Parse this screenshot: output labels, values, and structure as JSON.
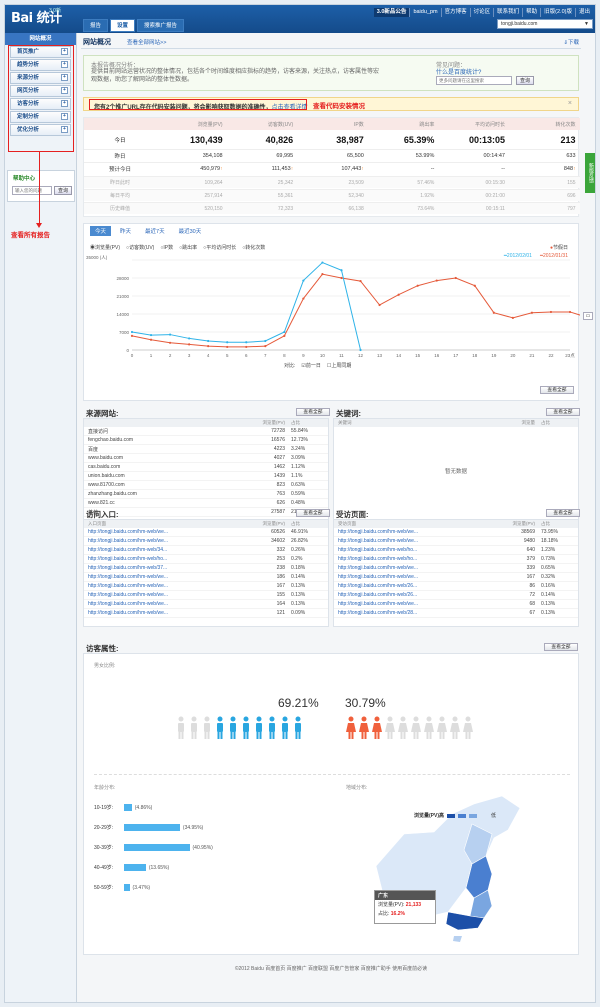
{
  "app": {
    "logo": "Bai 统计",
    "version": "3.0新",
    "tabs": [
      "报告",
      "设置",
      "搜索推广报告"
    ],
    "active_tab": 1,
    "userbar": [
      "3.0新品公告",
      "baidu_pm",
      "官方博客",
      "讨论区",
      "联系我们",
      "帮助",
      "旧版(2.0)版",
      "退出"
    ],
    "site_selector": "tongji.baidu.com"
  },
  "sidebar": {
    "head": "网站概况",
    "items": [
      "首页推广",
      "趋势分析",
      "来源分析",
      "网页分析",
      "访客分析",
      "定制分析",
      "优化分析"
    ],
    "help_title": "帮助中心",
    "help_placeholder": "输入您的问题",
    "help_button": "查询"
  },
  "annotations": {
    "all_reports": "查看所有报告",
    "code_install": "查看代码安装情况"
  },
  "page": {
    "title": "网站概况",
    "subtitle": "查看全部网站>>",
    "download": "下载"
  },
  "notice": {
    "title": "本报告概况分析：",
    "body": "提供目前网站运营状况的整体情况，包括各个时间维度相应指标的趋势，访客来源，关注热点，访客属性等宏观数据，助您了解网站的整体性数据。",
    "faq_title": "常见问题：",
    "faq_link": "什么是百度统计?",
    "search_placeholder": "更多问题请在这里搜索",
    "search_button": "查询"
  },
  "warning": {
    "text": "您有2个推广URL存在代码安装问题，将会影响获取数据的准确性，",
    "link": "点击查看详情",
    "close": "×"
  },
  "stats": {
    "headers": [
      "浏览量(PV)",
      "访客数(UV)",
      "IP数",
      "跳出率",
      "平均访问时长",
      "转化次数"
    ],
    "rows": [
      {
        "label": "今日",
        "values": [
          "130,439",
          "40,826",
          "38,987",
          "65.39%",
          "00:13:05",
          "213"
        ]
      },
      {
        "label": "昨日",
        "values": [
          "354,108",
          "69,995",
          "65,500",
          "53.99%",
          "00:14:47",
          "633"
        ]
      },
      {
        "label": "预计今日",
        "values": [
          "450,979",
          "111,453",
          "107,443",
          "--",
          "--",
          "848"
        ]
      },
      {
        "label": "昨日此时",
        "values": [
          "109,264",
          "25,342",
          "23,509",
          "57.46%",
          "00:15:30",
          "155"
        ]
      },
      {
        "label": "每日平均",
        "values": [
          "257,914",
          "55,361",
          "52,340",
          "1.92%",
          "00:21:00",
          "696"
        ]
      },
      {
        "label": "历史峰值",
        "values": [
          "520,150",
          "72,323",
          "66,138",
          "73.64%",
          "00:15:11",
          "797"
        ]
      }
    ],
    "up_mark": "↑"
  },
  "side_tab": "新版反馈",
  "chart_tabs": [
    "今天",
    "昨天",
    "最近7天",
    "最近30天"
  ],
  "chart_options": [
    "浏览量(PV)",
    "访客数(UV)",
    "IP数",
    "跳出率",
    "平均访问时长",
    "转化次数"
  ],
  "holiday": "节假日",
  "compare": {
    "label": "对比:",
    "day": "前一日",
    "week": "上周同期"
  },
  "view_all": "查看全部",
  "chart_data": {
    "type": "line",
    "x": [
      0,
      1,
      2,
      3,
      4,
      5,
      6,
      7,
      8,
      9,
      10,
      11,
      12,
      13,
      14,
      15,
      16,
      17,
      18,
      19,
      20,
      21,
      22,
      23
    ],
    "x_tick_labels": [
      "0",
      "1",
      "2",
      "3",
      "4",
      "5",
      "6",
      "7",
      "8",
      "9",
      "10",
      "11",
      "12",
      "13",
      "14",
      "15",
      "16",
      "17",
      "18",
      "19",
      "20",
      "21",
      "22",
      "23点"
    ],
    "ylabel": "35000 (人)",
    "ylim": [
      0,
      35000
    ],
    "yticks": [
      "35000",
      "28000",
      "21000",
      "14000",
      "7000",
      "0"
    ],
    "series": [
      {
        "name": "2012/02/01",
        "color": "#2fb3e8",
        "values": [
          7000,
          5800,
          6000,
          4500,
          3500,
          3000,
          3000,
          3500,
          7000,
          27000,
          34000,
          31000,
          0
        ]
      },
      {
        "name": "2012/01/31",
        "color": "#e55a3a",
        "values": [
          5500,
          4000,
          2800,
          2200,
          1500,
          1200,
          1200,
          1500,
          5500,
          20000,
          29500,
          28000,
          26800,
          17500,
          21500,
          25000,
          27000,
          28000,
          25000,
          14500,
          12500,
          14500,
          14800,
          14800,
          12500
        ]
      }
    ],
    "holiday_color": "#e55a3a"
  },
  "sources": {
    "title": "来源网站:",
    "button": "查看全部",
    "cols": [
      "浏览量(PV)",
      "占比"
    ],
    "rows": [
      [
        "直接访问",
        "72728",
        "55.84%",
        0.5584
      ],
      [
        "fengchao.baidu.com",
        "16576",
        "12.73%",
        0.1273
      ],
      [
        "百度",
        "4223",
        "3.24%",
        0.0324
      ],
      [
        "www.baidu.com",
        "4027",
        "3.09%",
        0.0309
      ],
      [
        "cas.baidu.com",
        "1462",
        "1.12%",
        0.0112
      ],
      [
        "union.baidu.com",
        "1439",
        "1.1%",
        0.011
      ],
      [
        "www.81700.com",
        "823",
        "0.63%",
        0.0063
      ],
      [
        "zhanzhang.baidu.com",
        "763",
        "0.59%",
        0.0059
      ],
      [
        "www.821.cc",
        "626",
        "0.48%",
        0.0048
      ],
      [
        "其他",
        "27587",
        "21.18%",
        0.2118
      ]
    ]
  },
  "keywords": {
    "title": "关键词:",
    "button": "查看全部",
    "cols": [
      "关键词",
      "浏览量",
      "占比"
    ],
    "empty": "暂无数据"
  },
  "entries": {
    "title": "访问入口:",
    "button": "查看全部",
    "cols": [
      "入口页面",
      "浏览量(PV)",
      "占比"
    ],
    "rows": [
      [
        "http://tongji.baidu.com/hm-web/we...",
        "60526",
        "46.91%",
        0.4691
      ],
      [
        "http://tongji.baidu.com/hm-web/we...",
        "34602",
        "26.82%",
        0.2682
      ],
      [
        "http://tongji.baidu.com/hm-web/34...",
        "332",
        "0.26%",
        0.0026
      ],
      [
        "http://tongji.baidu.com/hm-web/ho...",
        "253",
        "0.2%",
        0.002
      ],
      [
        "http://tongji.baidu.com/hm-web/37...",
        "238",
        "0.18%",
        0.0018
      ],
      [
        "http://tongji.baidu.com/hm-web/we...",
        "186",
        "0.14%",
        0.0014
      ],
      [
        "http://tongji.baidu.com/hm-web/we...",
        "167",
        "0.13%",
        0.0013
      ],
      [
        "http://tongji.baidu.com/hm-web/we...",
        "155",
        "0.13%",
        0.0013
      ],
      [
        "http://tongji.baidu.com/hm-web/we...",
        "164",
        "0.13%",
        0.0013
      ],
      [
        "http://tongji.baidu.com/hm-web/we...",
        "121",
        "0.09%",
        0.0009
      ]
    ]
  },
  "pages": {
    "title": "受访页面:",
    "button": "查看全部",
    "cols": [
      "受访页面",
      "浏览量(PV)",
      "占比"
    ],
    "rows": [
      [
        "http://tongji.baidu.com/hm-web/we...",
        "38569",
        "73.95%",
        0.7395
      ],
      [
        "http://tongji.baidu.com/hm-web/we...",
        "9480",
        "18.18%",
        0.1818
      ],
      [
        "http://tongji.baidu.com/hm-web/ho...",
        "640",
        "1.23%",
        0.0123
      ],
      [
        "http://tongji.baidu.com/hm-web/ho...",
        "379",
        "0.73%",
        0.0073
      ],
      [
        "http://tongji.baidu.com/hm-web/we...",
        "339",
        "0.65%",
        0.0065
      ],
      [
        "http://tongji.baidu.com/hm-web/we...",
        "167",
        "0.32%",
        0.0032
      ],
      [
        "http://tongji.baidu.com/hm-web/26...",
        "86",
        "0.16%",
        0.0016
      ],
      [
        "http://tongji.baidu.com/hm-web/26...",
        "72",
        "0.14%",
        0.0014
      ],
      [
        "http://tongji.baidu.com/hm-web/we...",
        "68",
        "0.13%",
        0.0013
      ],
      [
        "http://tongji.baidu.com/hm-web/28...",
        "67",
        "0.13%",
        0.0013
      ]
    ]
  },
  "visitor": {
    "title": "访客属性:",
    "button": "查看全部",
    "sex_label": "男女比例:",
    "male": "69.21%",
    "female": "30.79%",
    "male_share": 0.6921,
    "age_label": "年龄分布:",
    "map_label": "地域分布:",
    "ages": [
      {
        "label": "10-19岁:",
        "pct": "(4.86%)",
        "value": 4.86
      },
      {
        "label": "20-29岁:",
        "pct": "(34.95%)",
        "value": 34.95
      },
      {
        "label": "30-39岁:",
        "pct": "(40.95%)",
        "value": 40.95
      },
      {
        "label": "40-49岁:",
        "pct": "(13.65%)",
        "value": 13.65
      },
      {
        "label": "50-59岁:",
        "pct": "(3.47%)",
        "value": 3.47
      }
    ],
    "map_legend_title": "浏览量(PV)高",
    "map_legend_low": "低",
    "tip": {
      "region": "广东",
      "pv_label": "浏览量(PV):",
      "pv": "21,133",
      "share_label": "占比:",
      "share": "16.2%"
    }
  },
  "footer": "©2012 Baidu  百度首页  百度推广  百度联盟  百度广告管家  百度推广助手  使用百度前必读"
}
